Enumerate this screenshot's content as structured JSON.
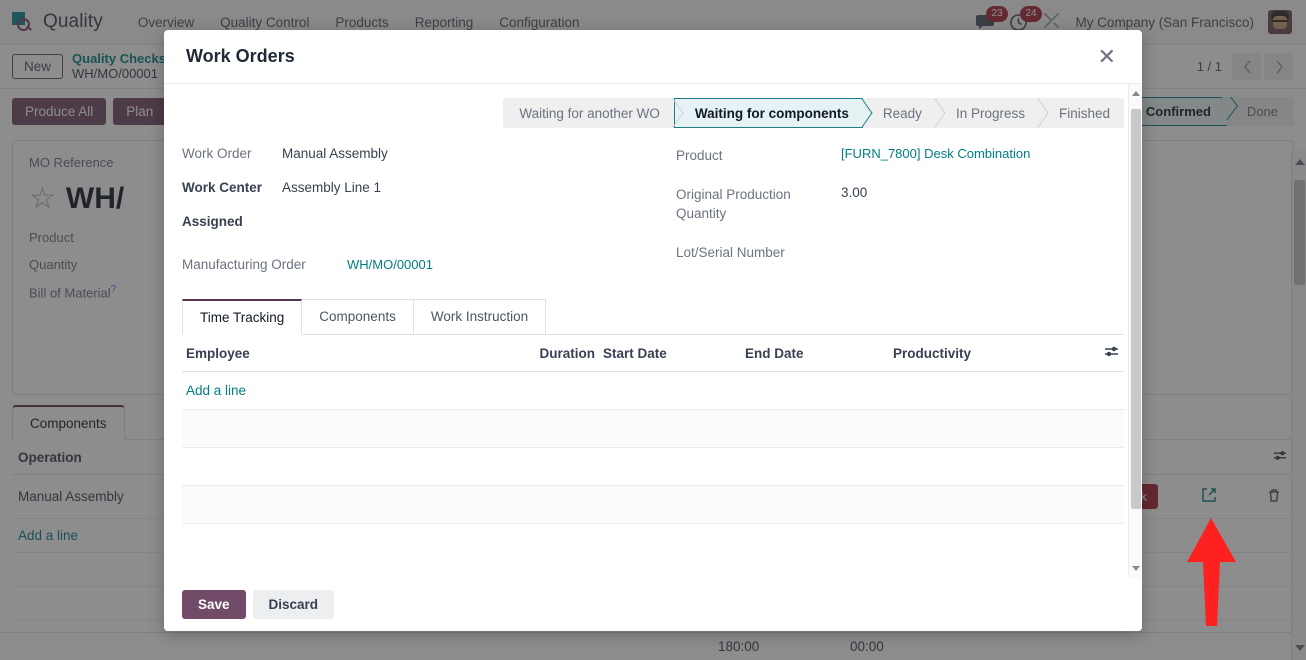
{
  "navbar": {
    "brand": "Quality",
    "brand_logo_icon": "quality-logo-icon",
    "menu": [
      "Overview",
      "Quality Control",
      "Products",
      "Reporting",
      "Configuration"
    ],
    "messages_icon": "chat-bubble-icon",
    "messages_count": "23",
    "activities_icon": "clock-icon",
    "activities_count": "24",
    "tools_icon": "wrench-screwdriver-icon",
    "company": "My Company (San Francisco)",
    "avatar_icon": "user-avatar"
  },
  "control_panel": {
    "new_label": "New",
    "breadcrumb_parent": "Quality Checks",
    "breadcrumb_current": "WH/MO/00001",
    "pager_count": "1 / 1",
    "prev_icon": "chevron-left-icon",
    "next_icon": "chevron-right-icon"
  },
  "background": {
    "buttons": [
      "Produce All",
      "Plan"
    ],
    "statusbar": [
      "Confirmed",
      "Done"
    ],
    "statusbar_active": "Confirmed",
    "fields": [
      {
        "label": "MO Reference",
        "bold": false
      },
      {
        "label": "Product",
        "bold": false
      },
      {
        "label": "Quantity",
        "bold": false
      },
      {
        "label": "Bill of Material",
        "bold": false,
        "help": "?"
      }
    ],
    "mo_reference_value": "WH/",
    "star_icon": "star-outline-icon",
    "tabs": [
      "Components"
    ],
    "table_header": "Operation",
    "table_rows": [
      "Manual Assembly"
    ],
    "add_a_line": "Add a line",
    "row_action_label": "ock",
    "external_link_icon": "external-link-icon",
    "delete_icon": "trash-icon",
    "options_icon": "sliders-icon",
    "totals": [
      "180:00",
      "00:00"
    ]
  },
  "modal": {
    "title": "Work Orders",
    "close_icon": "close-icon",
    "stages": [
      {
        "label": "Waiting for another WO",
        "active": false
      },
      {
        "label": "Waiting for components",
        "active": true
      },
      {
        "label": "Ready",
        "active": false
      },
      {
        "label": "In Progress",
        "active": false
      },
      {
        "label": "Finished",
        "active": false
      }
    ],
    "left_fields": [
      {
        "label": "Work Order",
        "value": "Manual Assembly",
        "bold": false,
        "link": false
      },
      {
        "label": "Work Center",
        "value": "Assembly Line 1",
        "bold": true,
        "link": false
      },
      {
        "label": "Assigned",
        "value": "",
        "bold": true,
        "link": false
      }
    ],
    "manufacturing_order": {
      "label": "Manufacturing Order",
      "value": "WH/MO/00001"
    },
    "right_fields": [
      {
        "label": "Product",
        "value": "[FURN_7800] Desk Combination",
        "link": true
      },
      {
        "label": "Original Production Quantity",
        "value": "3.00",
        "link": false
      },
      {
        "label": "Lot/Serial Number",
        "value": "",
        "link": false
      }
    ],
    "tabs": [
      {
        "label": "Time Tracking",
        "active": true
      },
      {
        "label": "Components",
        "active": false
      },
      {
        "label": "Work Instruction",
        "active": false
      }
    ],
    "table": {
      "columns": [
        "Employee",
        "Duration",
        "Start Date",
        "End Date",
        "Productivity"
      ],
      "options_icon": "sliders-icon",
      "rows": [],
      "add_a_line": "Add a line",
      "empty_row_count": 3
    },
    "save_label": "Save",
    "discard_label": "Discard"
  },
  "annotation": {
    "arrow_icon": "red-arrow-up-icon",
    "color": "#ff2020"
  },
  "colors": {
    "primary_purple": "#714b67",
    "teal_link": "#017e84",
    "active_stage_border": "#1d7f86",
    "active_stage_bg": "#e6f2f3",
    "badge_red": "#a52334",
    "tab_active_border": "#5a3650"
  }
}
